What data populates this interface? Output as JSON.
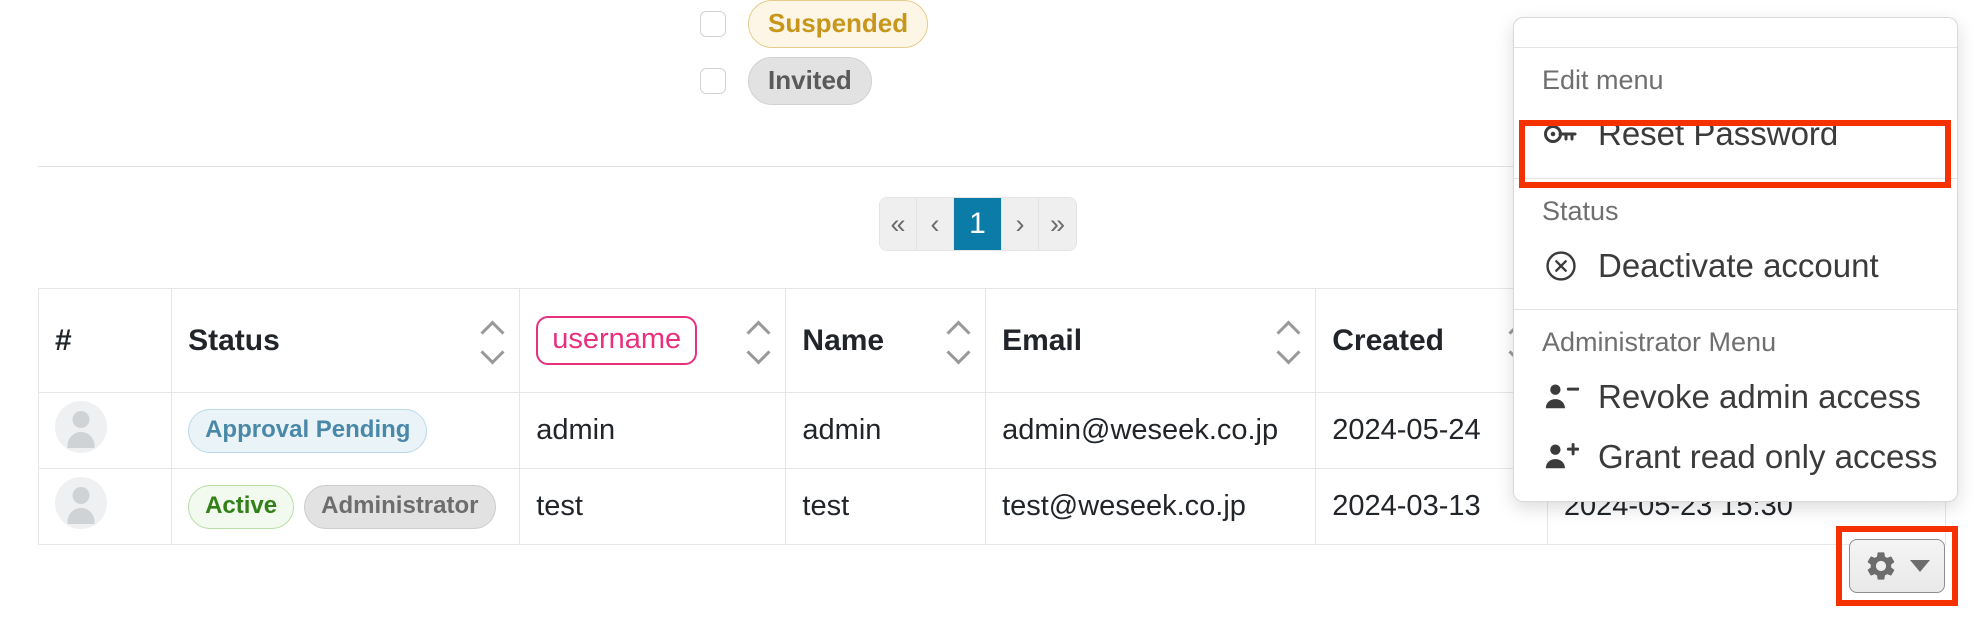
{
  "filters": [
    {
      "id": "suspended",
      "label": "Suspended",
      "checked": false,
      "style": "suspended"
    },
    {
      "id": "invited",
      "label": "Invited",
      "checked": false,
      "style": "invited"
    }
  ],
  "pagination": {
    "first_label": "«",
    "prev_label": "‹",
    "next_label": "›",
    "last_label": "»",
    "pages": [
      "1"
    ],
    "current_page": "1",
    "active_color": "#0b7ca8"
  },
  "table": {
    "columns": [
      {
        "key": "index",
        "label": "#",
        "sortable": false,
        "highlight": false
      },
      {
        "key": "status",
        "label": "Status",
        "sortable": true,
        "highlight": false
      },
      {
        "key": "username",
        "label": "username",
        "sortable": true,
        "highlight": true
      },
      {
        "key": "name",
        "label": "Name",
        "sortable": true,
        "highlight": false
      },
      {
        "key": "email",
        "label": "Email",
        "sortable": true,
        "highlight": false
      },
      {
        "key": "created",
        "label": "Created",
        "sortable": true,
        "highlight": false
      },
      {
        "key": "lastlogin",
        "label": "",
        "sortable": false,
        "highlight": false
      }
    ],
    "highlight_color": "#e8307f",
    "rows": [
      {
        "avatar": "user-avatar",
        "badges": [
          {
            "label": "Approval Pending",
            "style": "pending"
          }
        ],
        "username": "admin",
        "name": "admin",
        "email": "admin@weseek.co.jp",
        "created": "2024-05-24",
        "lastlogin": ""
      },
      {
        "avatar": "user-avatar",
        "badges": [
          {
            "label": "Active",
            "style": "active"
          },
          {
            "label": "Administrator",
            "style": "admin"
          }
        ],
        "username": "test",
        "name": "test",
        "email": "test@weseek.co.jp",
        "created": "2024-03-13",
        "lastlogin": "2024-05-23 15:30"
      }
    ]
  },
  "gear_button": {
    "icon": "gear-icon",
    "caret": "caret-down-icon",
    "highlight_color": "#f63100"
  },
  "dropdown": {
    "highlight_color": "#f63100",
    "sections": [
      {
        "header": "Edit menu",
        "items": [
          {
            "label": "Reset Password",
            "icon": "key-icon",
            "highlighted": true
          }
        ]
      },
      {
        "header": "Status",
        "items": [
          {
            "label": "Deactivate account",
            "icon": "circle-x-icon",
            "highlighted": false
          }
        ]
      },
      {
        "header": "Administrator Menu",
        "items": [
          {
            "label": "Revoke admin access",
            "icon": "person-minus-icon",
            "highlighted": false
          },
          {
            "label": "Grant read only access",
            "icon": "person-plus-icon",
            "highlighted": false
          }
        ]
      }
    ]
  }
}
